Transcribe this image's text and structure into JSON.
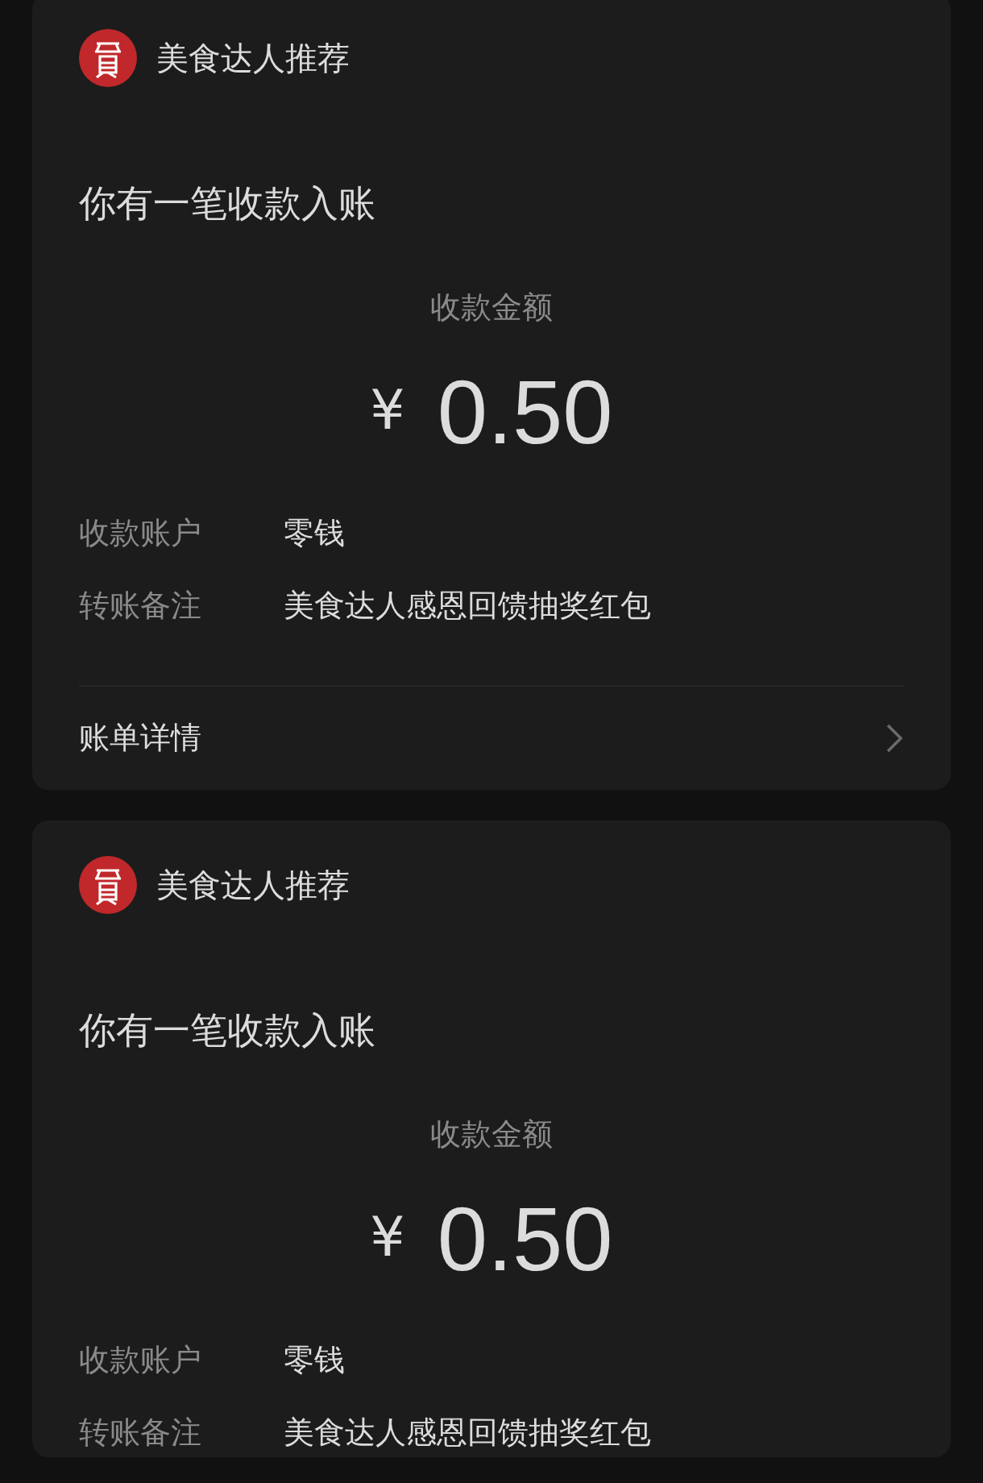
{
  "cards": [
    {
      "sender": "美食达人推荐",
      "title": "你有一笔收款入账",
      "amount_label": "收款金额",
      "currency": "¥",
      "amount": "0.50",
      "rows": [
        {
          "label": "收款账户",
          "value": "零钱"
        },
        {
          "label": "转账备注",
          "value": "美食达人感恩回馈抽奖红包"
        }
      ],
      "footer": "账单详情"
    },
    {
      "sender": "美食达人推荐",
      "title": "你有一笔收款入账",
      "amount_label": "收款金额",
      "currency": "¥",
      "amount": "0.50",
      "rows": [
        {
          "label": "收款账户",
          "value": "零钱"
        },
        {
          "label": "转账备注",
          "value": "美食达人感恩回馈抽奖红包"
        }
      ]
    }
  ]
}
